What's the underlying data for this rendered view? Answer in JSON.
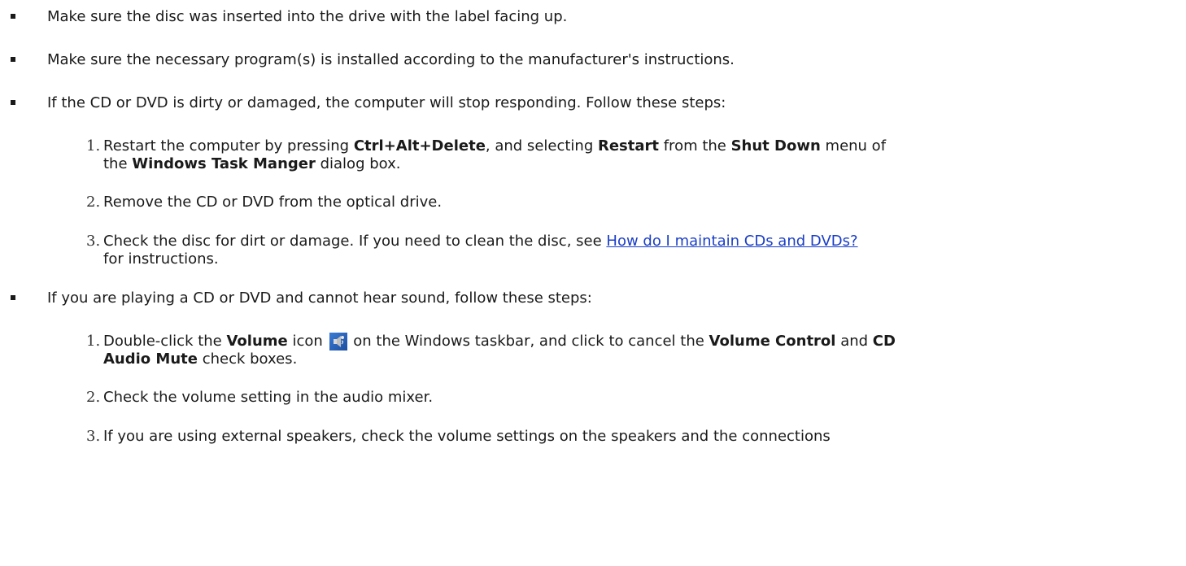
{
  "bullets": [
    {
      "text": "Make sure the disc was inserted into the drive with the label facing up."
    },
    {
      "text": "Make sure the necessary program(s) is installed according to the manufacturer's instructions."
    },
    {
      "text": "If the CD or DVD is dirty or damaged, the computer will stop responding. Follow these steps:"
    },
    {
      "text": "If you are playing a CD or DVD and cannot hear sound, follow these steps:"
    }
  ],
  "dirty_steps": {
    "step1": {
      "num": "1.",
      "a": "Restart the computer by pressing ",
      "b1": "Ctrl+Alt+Delete",
      "c": ", and selecting ",
      "b2": "Restart",
      "d": " from the ",
      "b3": "Shut Down",
      "e": " menu of",
      "line2_a": "the ",
      "b4": "Windows Task Manger",
      "line2_b": " dialog box."
    },
    "step2": {
      "num": "2.",
      "text": "Remove the CD or DVD from the optical drive."
    },
    "step3": {
      "num": "3.",
      "a": "Check the disc for dirt or damage. If you need to clean the disc, see ",
      "link": "How do I maintain CDs and DVDs?",
      "line2": "for instructions."
    }
  },
  "sound_steps": {
    "step1": {
      "num": "1.",
      "a": "Double-click the ",
      "b1": "Volume",
      "c": " icon",
      "d": " on the Windows taskbar, and click to cancel the ",
      "b2": "Volume Control",
      "e": " and ",
      "b3": "CD",
      "b4": "Audio Mute",
      "line2_b": " check boxes."
    },
    "step2": {
      "num": "2.",
      "text": "Check the volume setting in the audio mixer."
    },
    "step3": {
      "num": "3.",
      "text": "If you are using external speakers, check the volume settings on the speakers and the connections"
    }
  },
  "icons": {
    "volume": "speaker-volume-icon"
  }
}
